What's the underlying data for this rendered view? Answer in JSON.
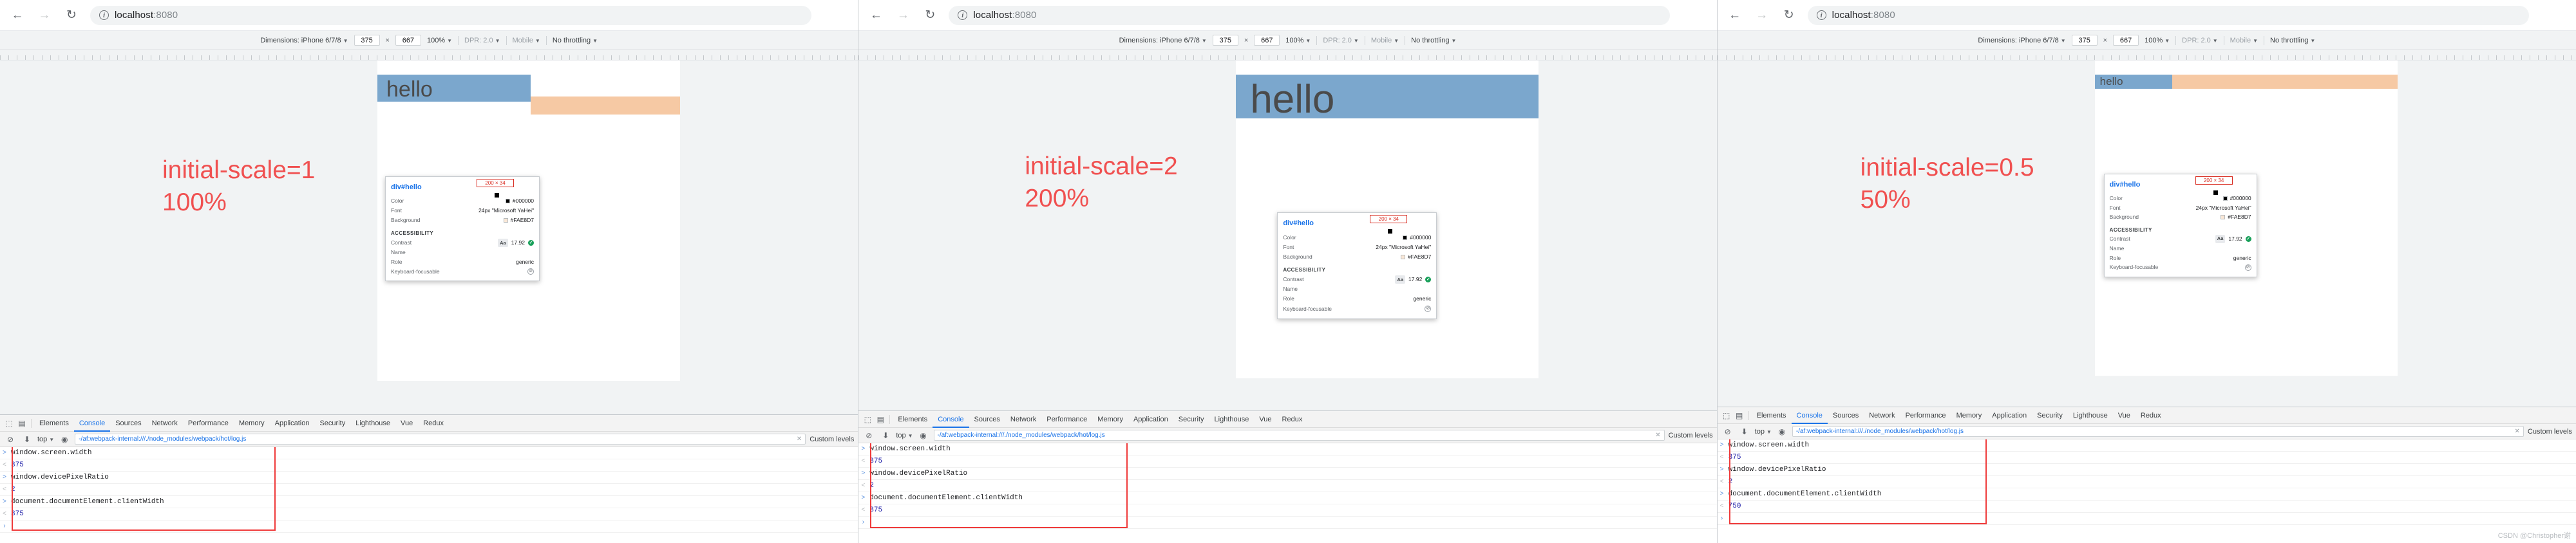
{
  "browser": {
    "back_icon": "←",
    "forward_icon": "→",
    "reload_icon": "↻",
    "info_icon": "i",
    "url_host": "localhost",
    "url_port": ":8080"
  },
  "device_toolbar": {
    "dimensions_label": "Dimensions: iPhone 6/7/8",
    "width": "375",
    "x_sign": "×",
    "height": "667",
    "zoom": "100%",
    "dpr_label": "DPR:",
    "dpr_value": "2.0",
    "network_type": "Mobile",
    "throttling": "No throttling",
    "caret": "▼"
  },
  "page": {
    "hello_text": "hello"
  },
  "captions": [
    {
      "line1": "initial-scale=1",
      "line2": "100%"
    },
    {
      "line1": "initial-scale=2",
      "line2": "200%"
    },
    {
      "line1": "initial-scale=0.5",
      "line2": "50%"
    }
  ],
  "inspector": {
    "title_selector": "div#hello",
    "size_badge": "200 × 34",
    "rows": [
      {
        "key": "Color",
        "value": "#000000",
        "swatch": "black"
      },
      {
        "key": "Font",
        "value": "24px \"Microsoft YaHei\"",
        "swatch": "none"
      },
      {
        "key": "Background",
        "value": "#FAE8D7",
        "swatch": "peach"
      }
    ],
    "section_label": "ACCESSIBILITY",
    "a11y_rows": [
      {
        "key": "Contrast",
        "badge": "Aa",
        "value": "17.92",
        "check": "✓"
      },
      {
        "key": "Name",
        "value": ""
      },
      {
        "key": "Role",
        "value": "generic"
      },
      {
        "key": "Keyboard-focusable",
        "value": "⊘"
      }
    ]
  },
  "devtools": {
    "inspect_icon": "⬚",
    "device_icon": "▤",
    "tabs": [
      {
        "label": "Elements",
        "active": false
      },
      {
        "label": "Console",
        "active": true
      },
      {
        "label": "Sources",
        "active": false
      },
      {
        "label": "Network",
        "active": false
      },
      {
        "label": "Performance",
        "active": false
      },
      {
        "label": "Memory",
        "active": false
      },
      {
        "label": "Application",
        "active": false
      },
      {
        "label": "Security",
        "active": false
      },
      {
        "label": "Lighthouse",
        "active": false
      },
      {
        "label": "Vue",
        "active": false
      },
      {
        "label": "Redux",
        "active": false
      }
    ],
    "filter_bar": {
      "clear_icon": "⊘",
      "filter_icon": "⬇",
      "context": "top",
      "caret": "▼",
      "eye_icon": "◉",
      "filter_value": "-/af:webpack-internal:///./node_modules/webpack/hot/log.js",
      "clear_x": "✕",
      "levels_label": "Custom levels"
    },
    "console_lines": [
      {
        "kind": "in",
        "text": "window.screen.width"
      },
      {
        "kind": "out",
        "text": "375"
      },
      {
        "kind": "in",
        "text": "window.devicePixelRatio"
      },
      {
        "kind": "out",
        "text": "2"
      },
      {
        "kind": "in",
        "text": "document.documentElement.clientWidth"
      },
      {
        "kind": "out",
        "text": "375"
      },
      {
        "kind": "prompt",
        "text": ""
      }
    ],
    "console_lines_p3": [
      {
        "kind": "in",
        "text": "window.screen.width"
      },
      {
        "kind": "out",
        "text": "375"
      },
      {
        "kind": "in",
        "text": "window.devicePixelRatio"
      },
      {
        "kind": "out",
        "text": "2"
      },
      {
        "kind": "in",
        "text": "document.documentElement.clientWidth"
      },
      {
        "kind": "out",
        "text": "750"
      },
      {
        "kind": "prompt",
        "text": ""
      }
    ],
    "prompt_arrow": "›"
  },
  "watermark": "CSDN @Christopher谢",
  "colors": {
    "accent_blue": "#1a73e8",
    "caption_red": "#f05050",
    "outline_red": "#ef3b3b",
    "band_blue": "#7ba7cd",
    "band_peach": "#f6c9a4",
    "bg_peach": "#FAE8D7"
  }
}
